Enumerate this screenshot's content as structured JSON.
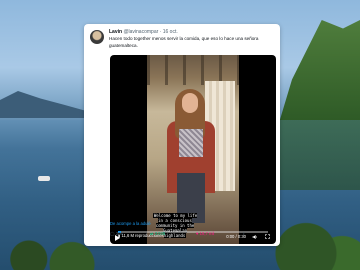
{
  "tweet": {
    "display_name": "Lavin",
    "handle_time": "@lavinacompar · 16 oct.",
    "text": "Hacen todo together menos servir la comida, que eso lo hace una señora guatemalteca.",
    "video": {
      "caption": "Welcome to my life in a conscious community in the Guatemalan highlands",
      "views": "11,6 M reproducciones",
      "time": "0:00 / 0:30",
      "progress": 0.02
    },
    "translate_label": "De acompe a la adulé",
    "actions": {
      "reply_count": "266",
      "retweet_count": "3.046",
      "like_count": "18,7 mil"
    }
  }
}
